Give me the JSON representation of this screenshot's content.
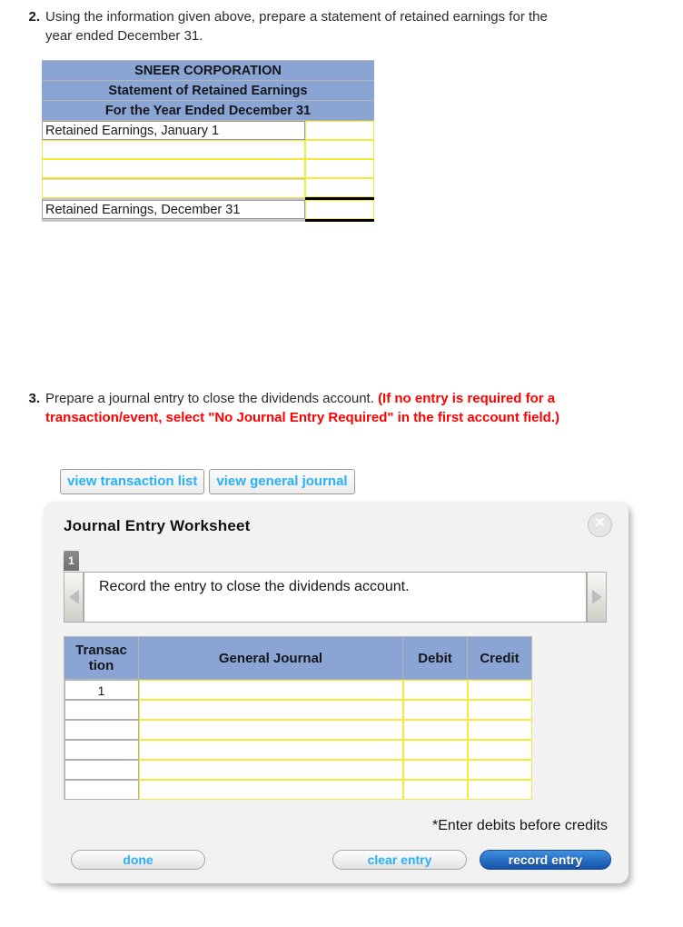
{
  "question2": {
    "number": "2.",
    "text": "Using the information given above, prepare a statement of retained earnings for the year ended December 31."
  },
  "retained_earnings_statement": {
    "header_lines": [
      "SNEER CORPORATION",
      "Statement of Retained Earnings",
      "For the Year Ended December 31"
    ],
    "rows": [
      {
        "label": "Retained Earnings, January 1",
        "label_editable": false,
        "amount": "",
        "total": false
      },
      {
        "label": "",
        "label_editable": true,
        "amount": "",
        "total": false
      },
      {
        "label": "",
        "label_editable": true,
        "amount": "",
        "total": false
      },
      {
        "label": "",
        "label_editable": true,
        "amount": "",
        "total": false
      },
      {
        "label": "Retained Earnings, December 31",
        "label_editable": false,
        "amount": "",
        "total": true
      }
    ]
  },
  "question3": {
    "number": "3.",
    "text": "Prepare a journal entry to close the dividends account. ",
    "alert": "(If no entry is required for a transaction/event, select \"No Journal Entry Required\" in the first account field.)"
  },
  "view_buttons": [
    {
      "label": "view transaction list"
    },
    {
      "label": "view general journal"
    }
  ],
  "worksheet": {
    "title": "Journal Entry Worksheet",
    "close_icon": "✕",
    "tabs": [
      {
        "label": "1"
      }
    ],
    "prev_arrow": "prev-arrow-icon",
    "next_arrow": "next-arrow-icon",
    "prompt": "Record the entry to close the dividends account.",
    "table": {
      "headers": {
        "transaction_line1": "Transac",
        "transaction_line2": "tion",
        "account": "General Journal",
        "debit": "Debit",
        "credit": "Credit"
      },
      "rows": [
        {
          "transaction": "1",
          "account": "",
          "debit": "",
          "credit": ""
        },
        {
          "transaction": "",
          "account": "",
          "debit": "",
          "credit": ""
        },
        {
          "transaction": "",
          "account": "",
          "debit": "",
          "credit": ""
        },
        {
          "transaction": "",
          "account": "",
          "debit": "",
          "credit": ""
        },
        {
          "transaction": "",
          "account": "",
          "debit": "",
          "credit": ""
        },
        {
          "transaction": "",
          "account": "",
          "debit": "",
          "credit": ""
        }
      ]
    },
    "note": "*Enter debits before credits",
    "footer_buttons": {
      "done": "done",
      "clear_entry": "clear entry",
      "record_entry": "record entry"
    }
  },
  "colors": {
    "table_header_blue": "#8aa4d4",
    "input_border_yellow": "#f2ea3c",
    "link_cyan": "#29b0fb",
    "alert_red": "#ff0000",
    "primary_button_blue": "#1552a8",
    "panel_background": "#f2f2f2"
  }
}
